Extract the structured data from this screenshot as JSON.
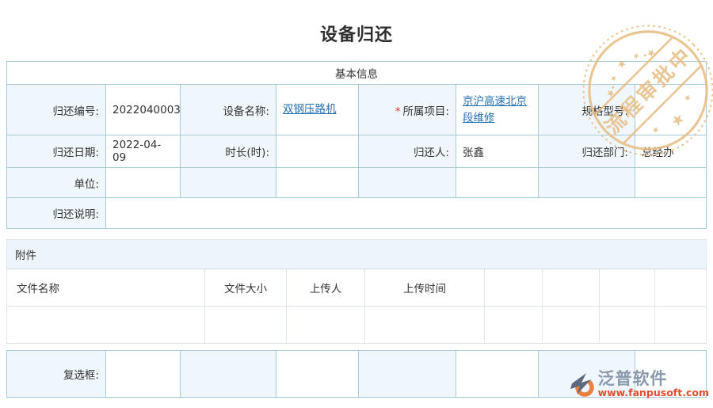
{
  "page": {
    "title": "设备归还",
    "required_marker": "*"
  },
  "stamp": {
    "text": "流程审批中",
    "color": "#e7bd82"
  },
  "icons": {
    "star": "★"
  },
  "colors": {
    "link": "#2570b3",
    "required": "#e03131",
    "table_outer_border": "#93b7c8",
    "cell_border": "#a6cbd9",
    "label_cell_bg": "#eff6fc",
    "section_header_bg": "#edf4fa",
    "stamp": "#e7bd82",
    "brand_text": "#8a99ad",
    "brand_url": "#e04e2f"
  },
  "basic_info": {
    "title": "基本信息",
    "fields": [
      {
        "label": "归还编号:",
        "value": "2022040003"
      },
      {
        "label": "设备名称:",
        "value": "双钢压路机"
      },
      {
        "label": "所属项目:",
        "value": "京沪高速北京段维修"
      },
      {
        "label": "规格型号:",
        "value": ""
      },
      {
        "label": "归还日期:",
        "value": "2022-04-09"
      },
      {
        "label": "时长(时):",
        "value": ""
      },
      {
        "label": "归还人:",
        "value": "张鑫"
      },
      {
        "label": "归还部门:",
        "value": "总经办"
      },
      {
        "label": "单位:",
        "value": ""
      },
      {
        "label": "归还说明:",
        "value": ""
      }
    ]
  },
  "attachments": {
    "title": "附件",
    "columns": [
      "文件名称",
      "文件大小",
      "上传人",
      "上传时间"
    ],
    "rows": []
  },
  "footer": {
    "checkbox_label": "复选框:"
  },
  "logo": {
    "brand": "泛普软件",
    "site": "www.fanpusoft.com"
  }
}
